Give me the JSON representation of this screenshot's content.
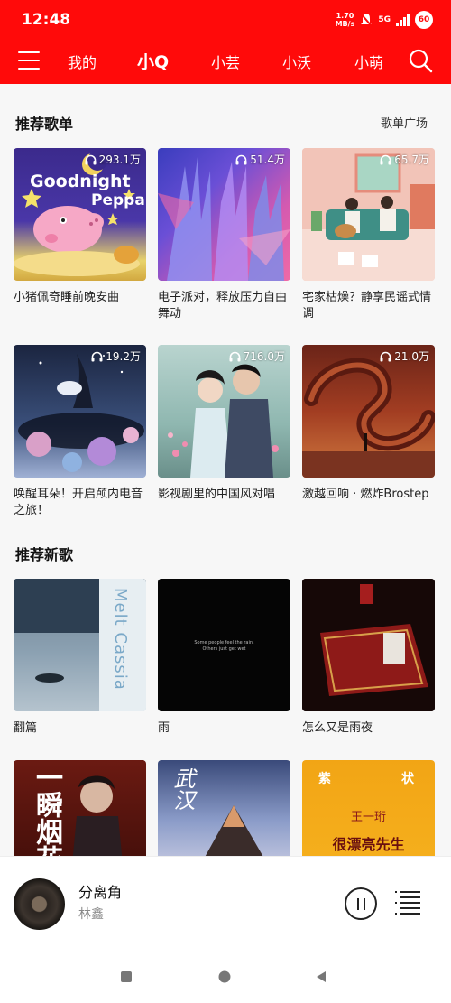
{
  "status": {
    "time": "12:48",
    "net_speed": "1.70",
    "net_unit": "MB/s",
    "network": "5G",
    "battery": "60"
  },
  "nav": {
    "tabs": [
      {
        "label": "我的"
      },
      {
        "label": "小Q"
      },
      {
        "label": "小芸"
      },
      {
        "label": "小沃"
      },
      {
        "label": "小萌"
      }
    ],
    "active_tab": "小Q"
  },
  "playlists": {
    "title": "推荐歌单",
    "more_label": "歌单广场",
    "items": [
      {
        "title": "小猪佩奇睡前晚安曲",
        "plays": "293.1万",
        "cover_text_1": "Goodnight",
        "cover_text_2": "Peppa"
      },
      {
        "title": "电子派对，释放压力自由舞动",
        "plays": "51.4万"
      },
      {
        "title": "宅家枯燥？静享民谣式情调",
        "plays": "65.7万"
      },
      {
        "title": "唤醒耳朵！开启颅内电音之旅！",
        "plays": "19.2万"
      },
      {
        "title": "影视剧里的中国风对唱",
        "plays": "716.0万"
      },
      {
        "title": "激越回响 · 燃炸Brostep",
        "plays": "21.0万"
      }
    ]
  },
  "new_songs": {
    "title": "推荐新歌",
    "items": [
      {
        "title": "翻篇",
        "cover_text": "Melt Cassia"
      },
      {
        "title": "雨",
        "cover_text_1": "Some people feel the rain,",
        "cover_text_2": "Others just get wet"
      },
      {
        "title": "怎么又是雨夜"
      },
      {
        "title": "",
        "cover_text": "一瞬烟花"
      },
      {
        "title": "",
        "cover_text": "武汉"
      },
      {
        "title": "",
        "cover_text_1": "紫",
        "cover_text_2": "状",
        "cover_text_3": "王一珩",
        "cover_text_4": "很漂亮先生"
      }
    ]
  },
  "player": {
    "song": "分离角",
    "artist": "林鑫"
  },
  "colors": {
    "brand": "#ff0a0a"
  }
}
